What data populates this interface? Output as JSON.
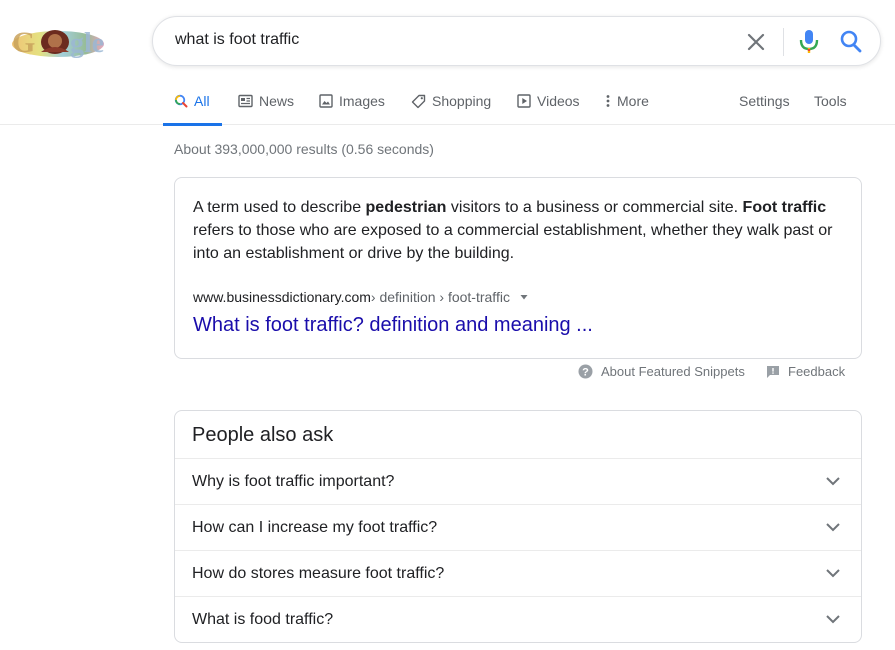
{
  "search": {
    "query": "what is foot traffic"
  },
  "tabs": [
    {
      "label": "All",
      "icon": "search-icon",
      "active": true
    },
    {
      "label": "News",
      "icon": "news-icon"
    },
    {
      "label": "Images",
      "icon": "image-icon"
    },
    {
      "label": "Shopping",
      "icon": "tag-icon"
    },
    {
      "label": "Videos",
      "icon": "play-icon"
    },
    {
      "label": "More",
      "icon": "more-vert-icon"
    }
  ],
  "tools": {
    "settings": "Settings",
    "tools": "Tools"
  },
  "result_stats": "About 393,000,000 results (0.56 seconds)",
  "snippet": {
    "part1": "A term used to describe ",
    "bold1": "pedestrian",
    "part2": " visitors to a business or commercial site. ",
    "bold2": "Foot traffic",
    "part3": " refers to those who are exposed to a commercial establishment, whether they walk past or into an establishment or drive by the building.",
    "cite_domain": "www.businessdictionary.com",
    "cite_path": " › definition › foot-traffic",
    "link_text": "What is foot traffic? definition and meaning ..."
  },
  "snippet_footer": {
    "about": "About Featured Snippets",
    "feedback": "Feedback"
  },
  "people_also_ask": {
    "heading": "People also ask",
    "questions": [
      "Why is foot traffic important?",
      "How can I increase my foot traffic?",
      "How do stores measure foot traffic?",
      "What is food traffic?"
    ]
  },
  "colors": {
    "accent": "#1a73e8",
    "link": "#1a0dab",
    "muted": "#70757a"
  }
}
